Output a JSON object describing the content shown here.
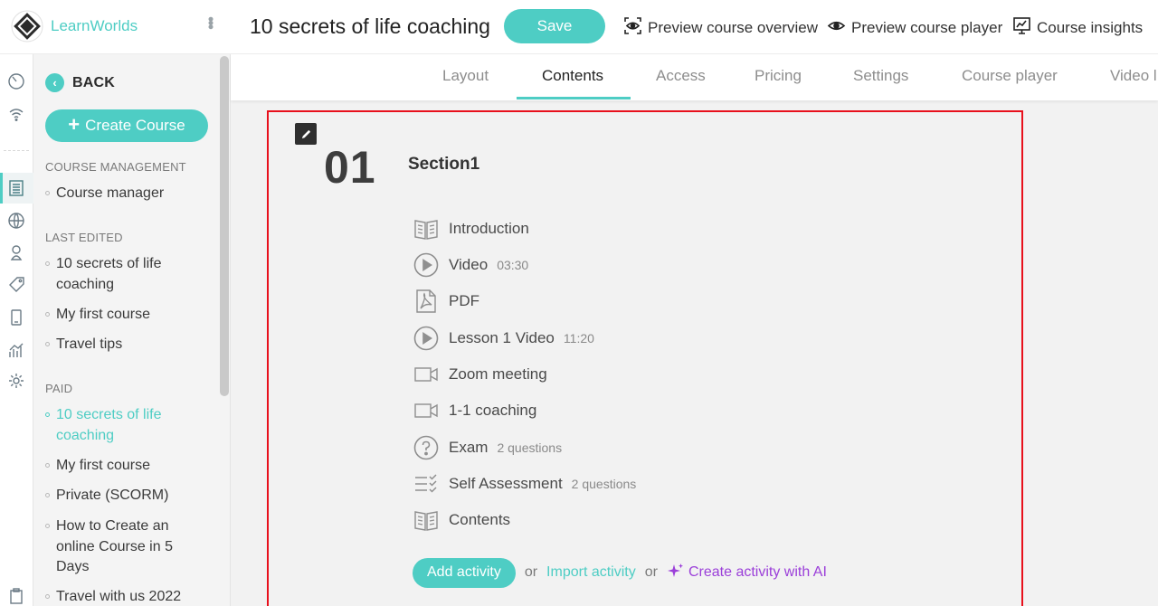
{
  "brand": {
    "name": "LearnWorlds"
  },
  "sidebar": {
    "back_label": "BACK",
    "create_label": "Create Course",
    "sections": [
      {
        "heading": "COURSE MANAGEMENT",
        "items": [
          {
            "label": "Course manager"
          }
        ]
      },
      {
        "heading": "LAST EDITED",
        "items": [
          {
            "label": "10 secrets of life coaching"
          },
          {
            "label": "My first course"
          },
          {
            "label": "Travel tips"
          }
        ]
      },
      {
        "heading": "PAID",
        "items": [
          {
            "label": "10 secrets of life coaching"
          },
          {
            "label": "My first course"
          },
          {
            "label": "Private (SCORM)"
          },
          {
            "label": "How to Create an online Course in 5 Days"
          },
          {
            "label": "Travel with us 2022"
          }
        ]
      }
    ]
  },
  "header": {
    "title": "10 secrets of life coaching",
    "save_label": "Save",
    "links": [
      "Preview course overview",
      "Preview course player",
      "Course insights"
    ]
  },
  "tabs": [
    "Layout",
    "Contents",
    "Access",
    "Pricing",
    "Settings",
    "Course player",
    "Video l"
  ],
  "active_tab": "Contents",
  "section": {
    "number": "01",
    "title": "Section1",
    "activities": [
      {
        "label": "Introduction",
        "meta": "",
        "icon": "ebook-icon"
      },
      {
        "label": "Video",
        "meta": "03:30",
        "icon": "play-icon"
      },
      {
        "label": "PDF",
        "meta": "",
        "icon": "pdf-icon"
      },
      {
        "label": "Lesson 1 Video",
        "meta": "11:20",
        "icon": "play-icon"
      },
      {
        "label": "Zoom meeting",
        "meta": "",
        "icon": "video-camera-icon"
      },
      {
        "label": "1-1 coaching",
        "meta": "",
        "icon": "video-camera-icon"
      },
      {
        "label": "Exam",
        "meta": "2 questions",
        "icon": "question-icon"
      },
      {
        "label": "Self Assessment",
        "meta": "2 questions",
        "icon": "checklist-icon"
      },
      {
        "label": "Contents",
        "meta": "",
        "icon": "ebook-icon"
      }
    ],
    "add_label": "Add activity",
    "or_label": "or",
    "import_label": "Import activity",
    "ai_label": "Create activity with AI"
  },
  "colors": {
    "accent": "#4ecdc4",
    "highlight_border": "#e8101c",
    "ai": "#9b3fd9"
  }
}
